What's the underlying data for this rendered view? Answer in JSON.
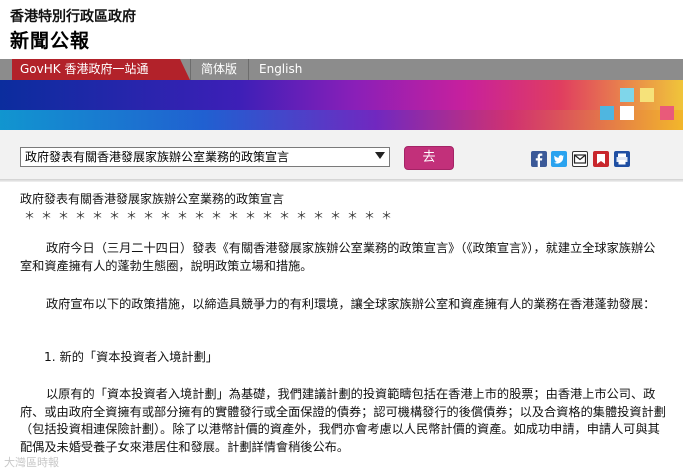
{
  "header": {
    "org_name": "香港特別行政區政府",
    "page_heading": "新聞公報"
  },
  "nav": {
    "govhk": "GovHK 香港政府一站通",
    "simplified": "简体版",
    "english": "English"
  },
  "toolbar": {
    "selected_title": "政府發表有關香港發展家族辦公室業務的政策宣言",
    "go_label": "去",
    "share_icons": [
      "facebook-icon",
      "twitter-icon",
      "email-icon",
      "bookmark-icon",
      "print-icon"
    ]
  },
  "article": {
    "title": "政府發表有關香港發展家族辦公室業務的政策宣言",
    "stars": "＊＊＊＊＊＊＊＊＊＊＊＊＊＊＊＊＊＊＊＊＊＊",
    "paragraphs": [
      "政府今日（三月二十四日）發表《有關香港發展家族辦公室業務的政策宣言》（《政策宣言》），就建立全球家族辦公室和資產擁有人的蓬勃生態圈，說明政策立場和措施。",
      "政府宣布以下的政策措施，以締造具競爭力的有利環境，讓全球家族辦公室和資產擁有人的業務在香港蓬勃發展：",
      "1. 新的「資本投資者入境計劃」",
      "以原有的「資本投資者入境計劃」為基礎，我們建議計劃的投資範疇包括在香港上市的股票；由香港上市公司、政府、或由政府全資擁有或部分擁有的實體發行或全面保證的債券；認可機構發行的後償債券；以及合資格的集體投資計劃（包括投資相連保險計劃）。除了以港幣計價的資產外，我們亦會考慮以人民幣計價的資產。如成功申請，申請人可與其配偶及未婚受養子女來港居住和發展。計劃詳情會稍後公布。"
    ]
  },
  "watermark": "大灣區時報",
  "colors": {
    "nav_red": "#b2222a",
    "go_button": "#c2307a",
    "nav_grey": "#8c8c8c"
  }
}
